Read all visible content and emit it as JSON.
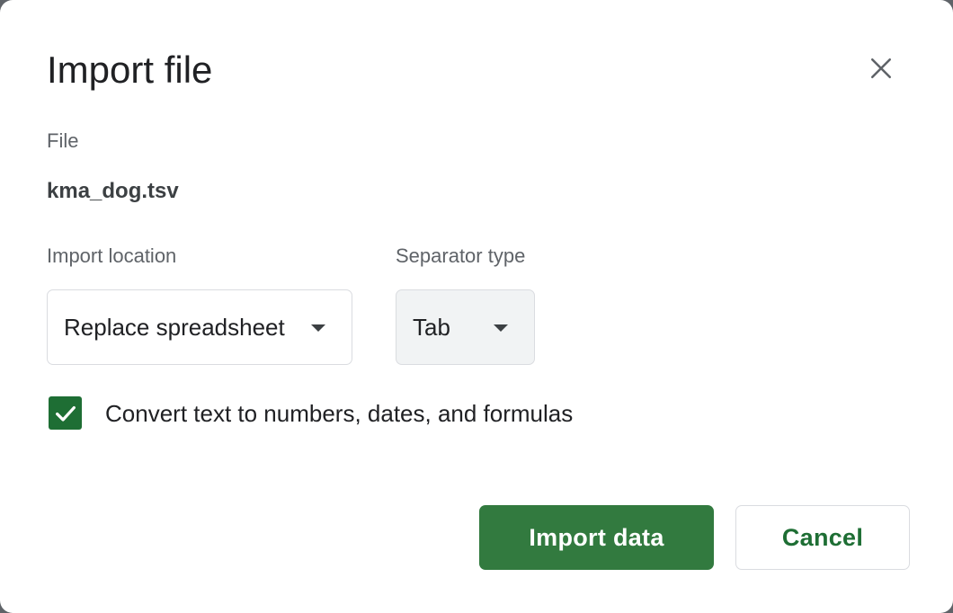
{
  "dialog": {
    "title": "Import file",
    "close_icon": "close-icon"
  },
  "file": {
    "label": "File",
    "name": "kma_dog.tsv"
  },
  "import_location": {
    "label": "Import location",
    "selected": "Replace spreadsheet"
  },
  "separator_type": {
    "label": "Separator type",
    "selected": "Tab"
  },
  "convert_option": {
    "label": "Convert text to numbers, dates, and formulas",
    "checked": true
  },
  "buttons": {
    "import_label": "Import data",
    "cancel_label": "Cancel"
  },
  "colors": {
    "accent": "#327a3f",
    "checkbox": "#1e6e34",
    "cancel_text": "#1e6e34",
    "separator_bg": "#f1f3f4",
    "border": "#dadce0"
  }
}
